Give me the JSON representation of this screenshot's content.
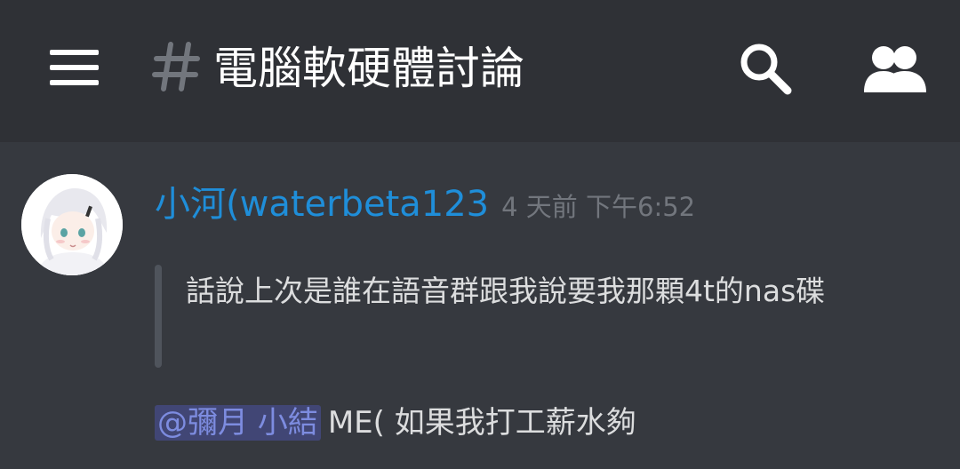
{
  "header": {
    "channel_name": "電腦軟硬體討論",
    "icons": {
      "menu": "hamburger-menu-icon",
      "hash": "channel-hash-icon",
      "search": "search-icon",
      "members": "members-icon"
    }
  },
  "message": {
    "username": "小河(waterbeta123",
    "timestamp": "4 天前 下午6:52",
    "quote": "話說上次是誰在語音群跟我說要我那顆4t的nas碟",
    "mention": "@彌月 小結",
    "text": "ME( 如果我打工薪水夠"
  },
  "colors": {
    "background": "#36393f",
    "header_background": "#2f3136",
    "username": "#1f8ed9",
    "mention_background": "#414675",
    "mention_text": "#7d8ce0"
  }
}
